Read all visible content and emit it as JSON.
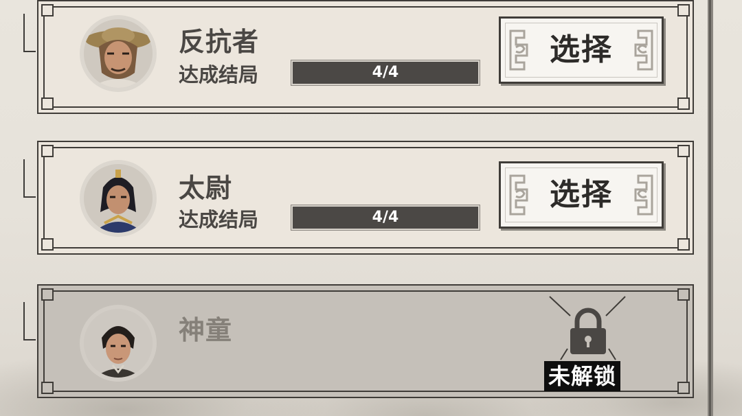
{
  "characters": [
    {
      "name": "反抗者",
      "status": "达成结局",
      "progress": "4/4",
      "action": "选择",
      "unlocked": true
    },
    {
      "name": "太尉",
      "status": "达成结局",
      "progress": "4/4",
      "action": "选择",
      "unlocked": true
    },
    {
      "name": "神童",
      "locked_label": "未解锁",
      "unlocked": false
    }
  ],
  "icons": {
    "lock": "lock-icon",
    "ornament": "scroll-ornament-icon"
  },
  "colors": {
    "card_bg": "#ece6dd",
    "locked_bg": "#c5c0b9",
    "bar": "#4b4845",
    "border": "#3f3c38"
  }
}
